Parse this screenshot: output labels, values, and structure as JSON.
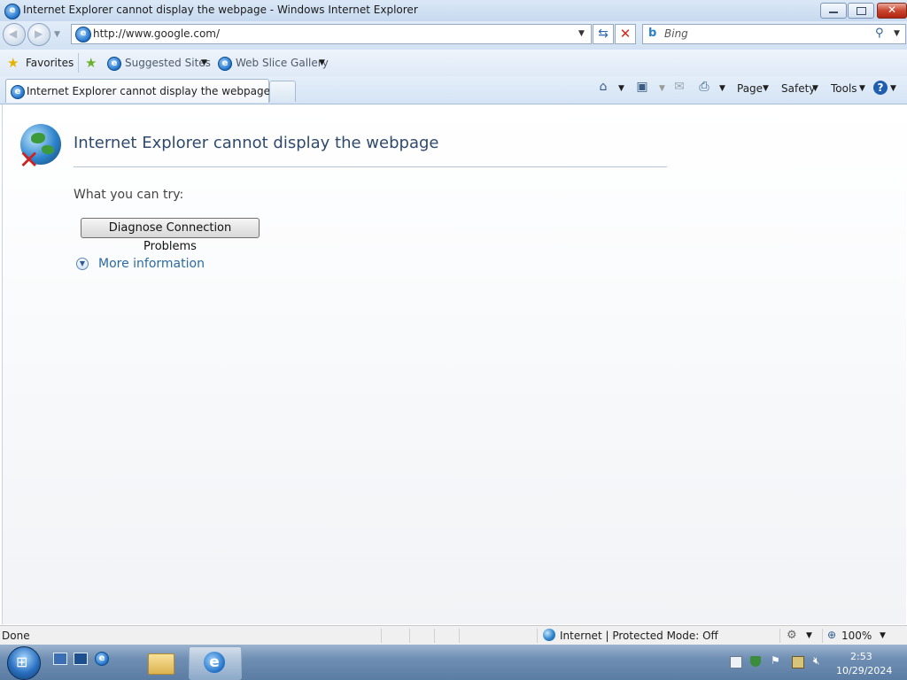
{
  "window": {
    "title": "Internet Explorer cannot display the webpage - Windows Internet Explorer"
  },
  "navigation": {
    "address": "http://www.google.com/",
    "search_placeholder": "Bing"
  },
  "favorites_bar": {
    "favorites_label": "Favorites",
    "items": [
      {
        "label": "Suggested Sites"
      },
      {
        "label": "Web Slice Gallery"
      }
    ]
  },
  "tabs": [
    {
      "label": "Internet Explorer cannot display the webpage"
    }
  ],
  "command_bar": {
    "page_label": "Page",
    "safety_label": "Safety",
    "tools_label": "Tools"
  },
  "error_page": {
    "title": "Internet Explorer cannot display the webpage",
    "try_label": "What you can try:",
    "diagnose_button": "Diagnose Connection Problems",
    "more_info": "More information"
  },
  "status_bar": {
    "status": "Done",
    "zone": "Internet | Protected Mode: Off",
    "zoom": "100%"
  },
  "taskbar": {
    "time": "2:53",
    "date": "10/29/2024"
  },
  "icons": {
    "ie_logo": "ie-icon",
    "error_globe": "globe-error-icon",
    "favorites": "star-icon"
  }
}
